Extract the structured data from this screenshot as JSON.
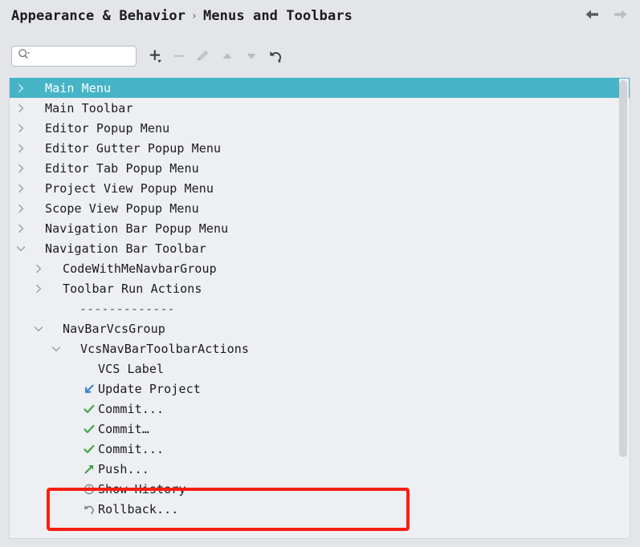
{
  "header": {
    "breadcrumb": [
      "Appearance & Behavior",
      "Menus and Toolbars"
    ],
    "separator": "›",
    "back_icon": "arrow-left-icon",
    "forward_icon": "arrow-right-icon"
  },
  "toolbar": {
    "search": {
      "value": "",
      "placeholder": ""
    },
    "buttons": [
      {
        "name": "add-button",
        "glyph": "+",
        "enabled": true,
        "dropdown": true
      },
      {
        "name": "remove-button",
        "glyph": "−",
        "enabled": false,
        "dropdown": false
      },
      {
        "name": "edit-button",
        "glyph": "pencil",
        "enabled": false,
        "dropdown": false
      },
      {
        "name": "move-up-button",
        "glyph": "▲",
        "enabled": false,
        "dropdown": false
      },
      {
        "name": "move-down-button",
        "glyph": "▼",
        "enabled": false,
        "dropdown": false
      },
      {
        "name": "restore-button",
        "glyph": "revert",
        "enabled": true,
        "dropdown": true
      }
    ]
  },
  "tree": {
    "rows": [
      {
        "label": "Main Menu",
        "indent": 0,
        "state": "collapsed",
        "selected": true,
        "icon": ""
      },
      {
        "label": "Main Toolbar",
        "indent": 0,
        "state": "collapsed",
        "selected": false,
        "icon": ""
      },
      {
        "label": "Editor Popup Menu",
        "indent": 0,
        "state": "collapsed",
        "selected": false,
        "icon": ""
      },
      {
        "label": "Editor Gutter Popup Menu",
        "indent": 0,
        "state": "collapsed",
        "selected": false,
        "icon": ""
      },
      {
        "label": "Editor Tab Popup Menu",
        "indent": 0,
        "state": "collapsed",
        "selected": false,
        "icon": ""
      },
      {
        "label": "Project View Popup Menu",
        "indent": 0,
        "state": "collapsed",
        "selected": false,
        "icon": ""
      },
      {
        "label": "Scope View Popup Menu",
        "indent": 0,
        "state": "collapsed",
        "selected": false,
        "icon": ""
      },
      {
        "label": "Navigation Bar Popup Menu",
        "indent": 0,
        "state": "collapsed",
        "selected": false,
        "icon": ""
      },
      {
        "label": "Navigation Bar Toolbar",
        "indent": 0,
        "state": "expanded",
        "selected": false,
        "icon": ""
      },
      {
        "label": "CodeWithMeNavbarGroup",
        "indent": 1,
        "state": "collapsed",
        "selected": false,
        "icon": ""
      },
      {
        "label": "Toolbar Run Actions",
        "indent": 1,
        "state": "collapsed",
        "selected": false,
        "icon": ""
      },
      {
        "label": "-------------",
        "indent": 2,
        "state": "separator",
        "selected": false,
        "icon": ""
      },
      {
        "label": "NavBarVcsGroup",
        "indent": 1,
        "state": "expanded",
        "selected": false,
        "icon": ""
      },
      {
        "label": "VcsNavBarToolbarActions",
        "indent": 2,
        "state": "expanded",
        "selected": false,
        "icon": ""
      },
      {
        "label": "VCS Label",
        "indent": 3,
        "state": "leaf",
        "selected": false,
        "icon": ""
      },
      {
        "label": "Update Project",
        "indent": 3,
        "state": "leaf",
        "selected": false,
        "icon": "update-project-icon"
      },
      {
        "label": "Commit...",
        "indent": 3,
        "state": "leaf",
        "selected": false,
        "icon": "commit-icon"
      },
      {
        "label": "Commit…",
        "indent": 3,
        "state": "leaf",
        "selected": false,
        "icon": "commit-icon"
      },
      {
        "label": "Commit...",
        "indent": 3,
        "state": "leaf",
        "selected": false,
        "icon": "commit-icon"
      },
      {
        "label": "Push...",
        "indent": 3,
        "state": "leaf",
        "selected": false,
        "icon": "push-icon"
      },
      {
        "label": "Show History",
        "indent": 3,
        "state": "leaf",
        "selected": false,
        "icon": "history-icon"
      },
      {
        "label": "Rollback...",
        "indent": 3,
        "state": "leaf",
        "selected": false,
        "icon": "rollback-icon"
      }
    ]
  },
  "colors": {
    "selection": "#45b4c6",
    "panel_bg": "#edeff2",
    "header_bg": "#e3e5e9",
    "annotation": "#fb1d10",
    "commit_green": "#42a847",
    "update_blue": "#3b82d6",
    "push_green": "#3da047",
    "icon_gray": "#7d8189"
  },
  "annotation": {
    "shape": "rectangle",
    "target": "Rollback..."
  }
}
